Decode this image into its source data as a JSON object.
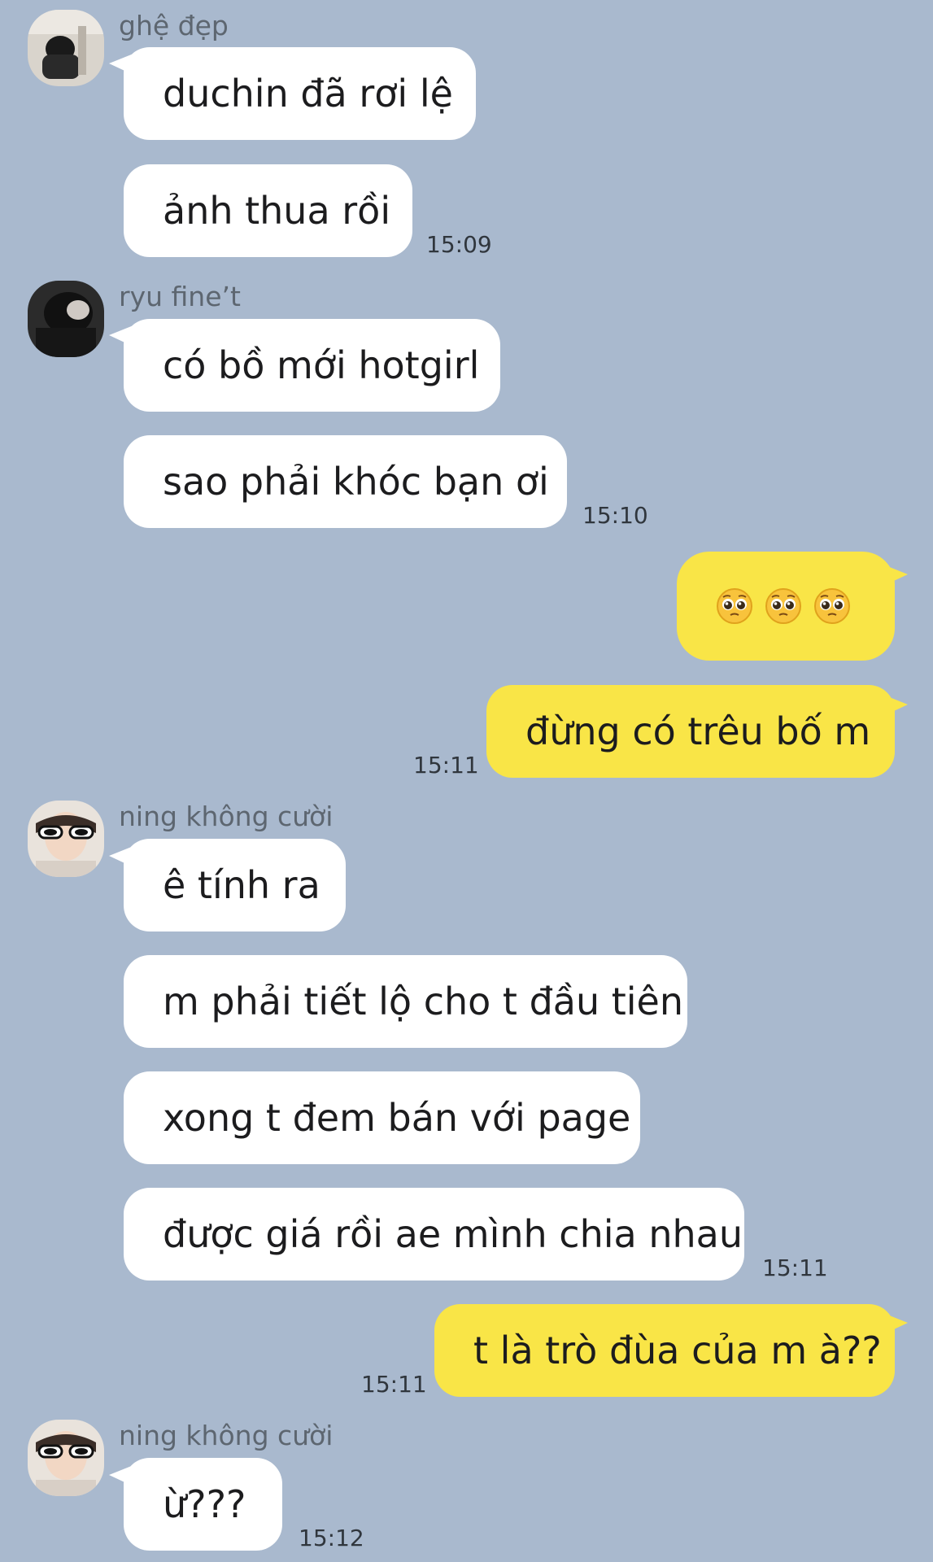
{
  "groups": [
    {
      "sender": "ghệ đẹp",
      "messages": [
        "duchin đã rơi lệ",
        "ảnh thua rồi"
      ],
      "time": "15:09"
    },
    {
      "sender": "ryu fine’t",
      "messages": [
        "có bồ mới hotgirl",
        "sao phải khóc bạn ơi"
      ],
      "time": "15:10"
    },
    {
      "sender": "me",
      "messages": [
        "emoji:pleading-face×3",
        "đừng có trêu bố m"
      ],
      "time": "15:11"
    },
    {
      "sender": "ning không cười",
      "messages": [
        "ê tính ra",
        "m phải tiết lộ cho t đầu tiên",
        "xong t đem bán với page",
        "được giá rồi ae mình chia nhau"
      ],
      "time": "15:11"
    },
    {
      "sender": "me",
      "messages": [
        "t là trò đùa của m à??"
      ],
      "time": "15:11"
    },
    {
      "sender": "ning không cười",
      "messages": [
        "ừ???"
      ],
      "time": "15:12"
    }
  ],
  "colors": {
    "background": "#a9b9ce",
    "incoming_bubble": "#ffffff",
    "outgoing_bubble": "#f9e547"
  }
}
